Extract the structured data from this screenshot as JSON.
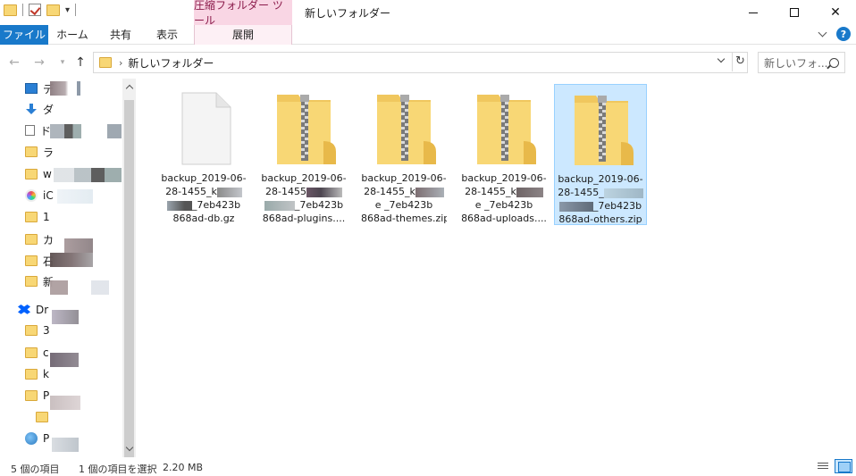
{
  "window": {
    "title": "新しいフォルダー",
    "context_tab_header": "圧縮フォルダー ツール"
  },
  "ribbon": {
    "tabs": [
      "ファイル",
      "ホーム",
      "共有",
      "表示",
      "展開"
    ]
  },
  "address": {
    "crumb": "新しいフォルダー",
    "search_placeholder": "新しいフォ..."
  },
  "nav_pane": {
    "items": [
      {
        "label": "デ",
        "icon": "desktop-icon"
      },
      {
        "label": "ダ",
        "icon": "download-icon"
      },
      {
        "label": "ド",
        "icon": "document-icon"
      },
      {
        "label": "ラ",
        "icon": "folder-icon"
      },
      {
        "label": "w",
        "icon": "folder-icon"
      },
      {
        "label": "iC",
        "icon": "icloud-icon"
      },
      {
        "label": "1",
        "icon": "folder-icon"
      },
      {
        "label": "カ",
        "icon": "folder-icon"
      },
      {
        "label": "石",
        "icon": "folder-icon"
      },
      {
        "label": "新",
        "icon": "folder-icon"
      },
      {
        "label": "Dr",
        "icon": "dropbox-icon"
      },
      {
        "label": "3",
        "icon": "folder-icon"
      },
      {
        "label": "c",
        "icon": "folder-icon"
      },
      {
        "label": "k",
        "icon": "folder-icon"
      },
      {
        "label": "P",
        "icon": "folder-icon"
      },
      {
        "label": "",
        "icon": "folder-icon"
      },
      {
        "label": "P",
        "icon": "globe-icon"
      }
    ]
  },
  "files": [
    {
      "line1": "backup_2019-06-",
      "line2": "28-1455_k",
      "line3": "_7eb423b",
      "line4": "868ad-db.gz",
      "type": "gz"
    },
    {
      "line1": "backup_2019-06-",
      "line2": "28-1455",
      "line3": "_7eb423b",
      "line4": "868ad-plugins....",
      "type": "zip"
    },
    {
      "line1": "backup_2019-06-",
      "line2": "28-1455_k",
      "line3": "e _7eb423b",
      "line4": "868ad-themes.zip",
      "type": "zip"
    },
    {
      "line1": "backup_2019-06-",
      "line2": "28-1455_k",
      "line3": "e _7eb423b",
      "line4": "868ad-uploads....",
      "type": "zip"
    },
    {
      "line1": "backup_2019-06-",
      "line2": "28-1455_",
      "line3": "_7eb423b",
      "line4": "868ad-others.zip",
      "type": "zip",
      "selected": true
    }
  ],
  "status": {
    "count": "5 個の項目",
    "selected": "1 個の項目を選択",
    "size": "2.20 MB"
  }
}
